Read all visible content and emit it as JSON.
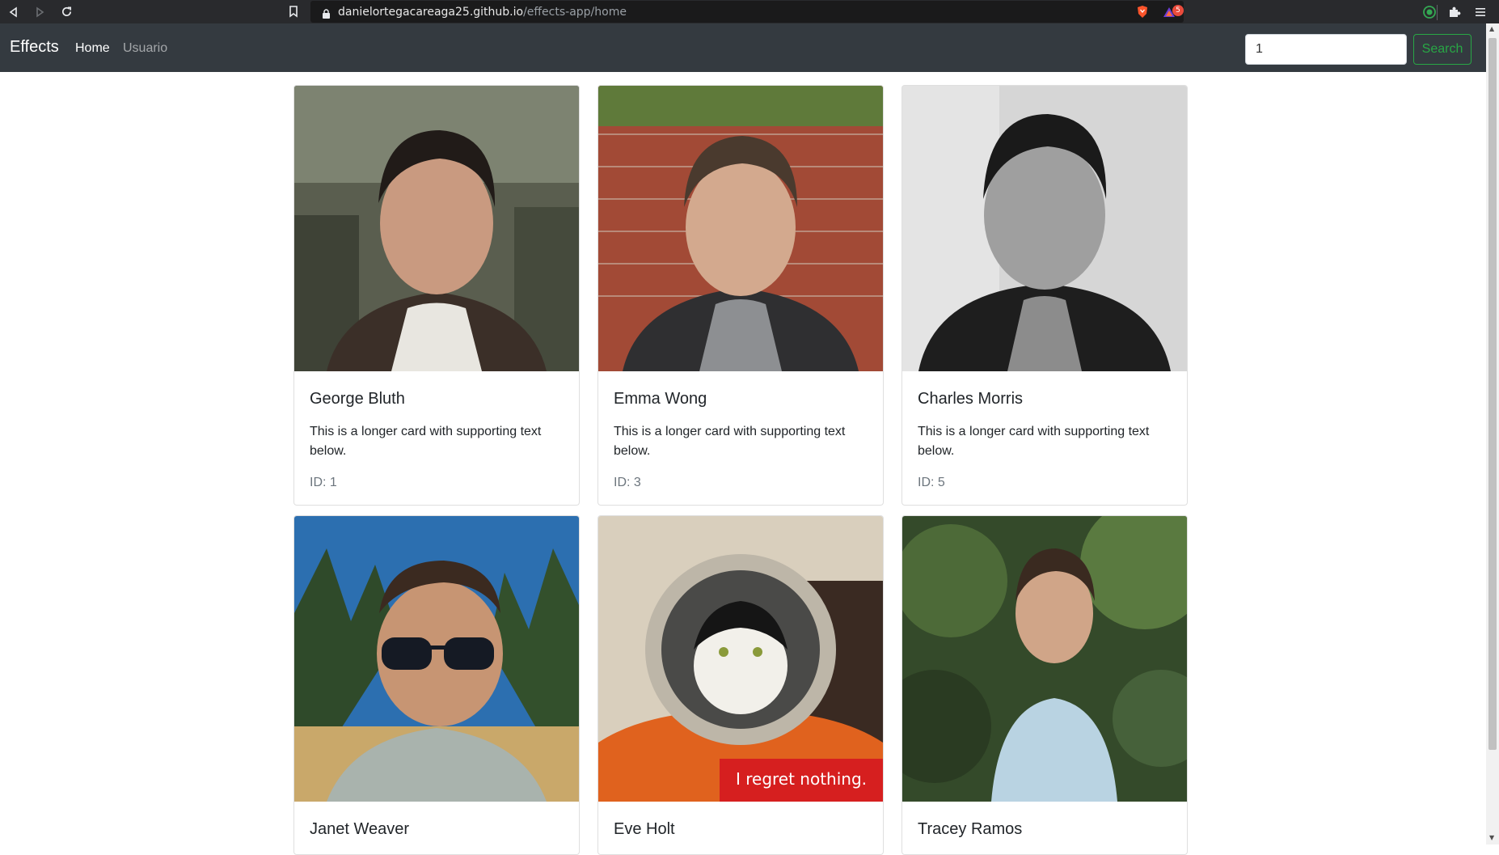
{
  "browser": {
    "url_host": "danielortegacareaga25.github.io",
    "url_path": "/effects-app/home",
    "notification_count": "5"
  },
  "navbar": {
    "brand": "Effects",
    "links": [
      {
        "label": "Home",
        "active": true
      },
      {
        "label": "Usuario",
        "active": false
      }
    ],
    "search": {
      "value": "1",
      "button_label": "Search"
    }
  },
  "colors": {
    "navbar_bg": "#343a40",
    "search_accent": "#28a745",
    "muted_text": "#6c757d"
  },
  "cards": [
    {
      "name": "George Bluth",
      "text": "This is a longer card with supporting text below.",
      "id_label": "ID: 1"
    },
    {
      "name": "Emma Wong",
      "text": "This is a longer card with supporting text below.",
      "id_label": "ID: 3"
    },
    {
      "name": "Charles Morris",
      "text": "This is a longer card with supporting text below.",
      "id_label": "ID: 5"
    },
    {
      "name": "Janet Weaver",
      "text": "",
      "id_label": ""
    },
    {
      "name": "Eve Holt",
      "text": "",
      "id_label": "",
      "image_caption": "I regret nothing."
    },
    {
      "name": "Tracey Ramos",
      "text": "",
      "id_label": ""
    }
  ]
}
